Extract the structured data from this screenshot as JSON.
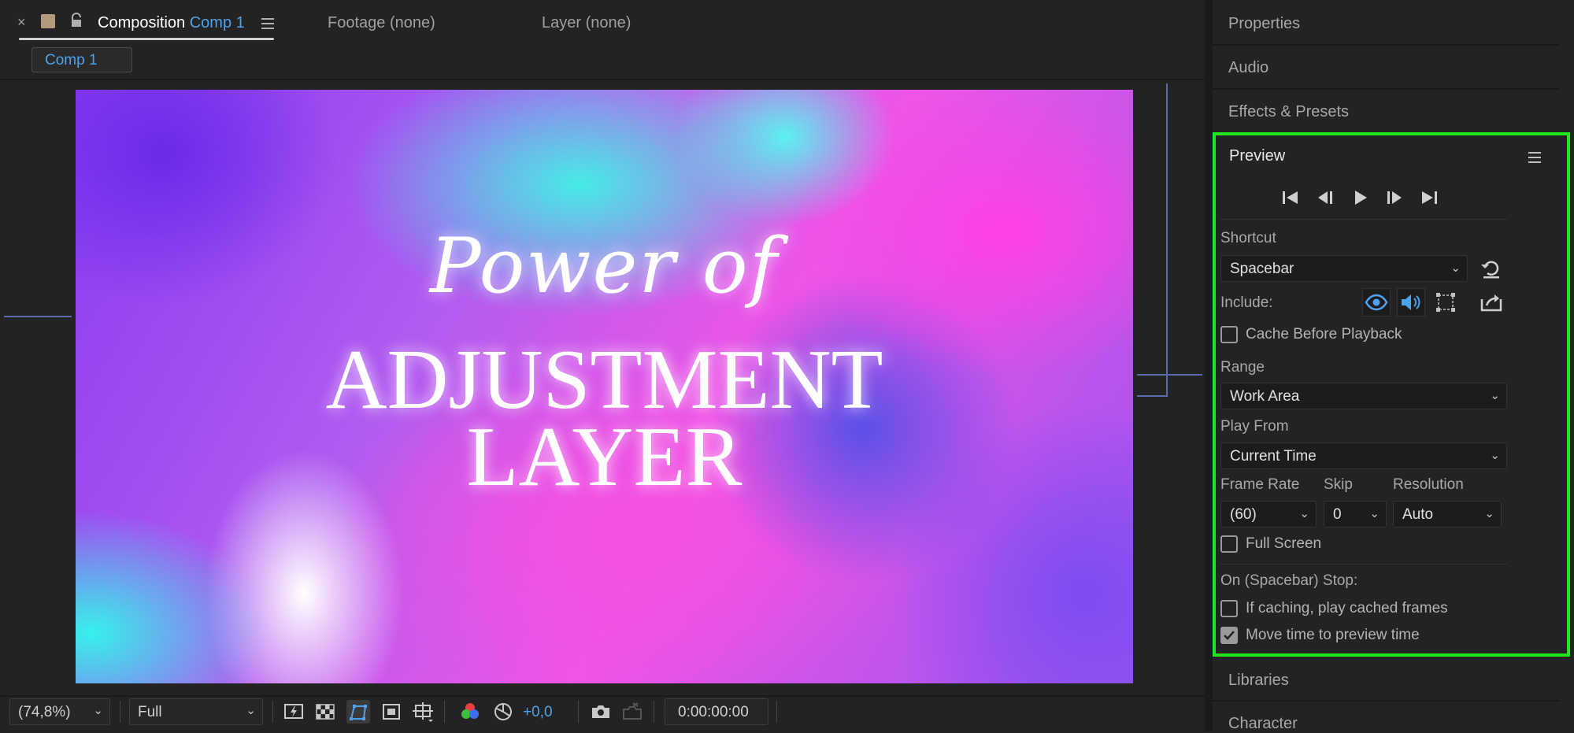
{
  "tabs": {
    "close_glyph": "×",
    "composition_label": "Composition",
    "composition_name": "Comp 1",
    "footage_label": "Footage (none)",
    "layer_label": "Layer (none)",
    "subtab_label": "Comp 1"
  },
  "canvas": {
    "script_title": "Power of",
    "main_title_line1": "ADJUSTMENT",
    "main_title_line2": "LAYER"
  },
  "bottom_toolbar": {
    "zoom_value": "(74,8%)",
    "resolution_value": "Full",
    "exposure_value": "+0,0",
    "timecode": "0:00:00:00"
  },
  "right_panel": {
    "properties": "Properties",
    "audio": "Audio",
    "effects_presets": "Effects & Presets",
    "libraries": "Libraries",
    "character": "Character"
  },
  "preview": {
    "title": "Preview",
    "shortcut_label": "Shortcut",
    "shortcut_value": "Spacebar",
    "include_label": "Include:",
    "cache_before_playback": "Cache Before Playback",
    "range_label": "Range",
    "range_value": "Work Area",
    "play_from_label": "Play From",
    "play_from_value": "Current Time",
    "frame_rate_label": "Frame Rate",
    "frame_rate_value": "(60)",
    "skip_label": "Skip",
    "skip_value": "0",
    "resolution_label": "Resolution",
    "resolution_value": "Auto",
    "full_screen": "Full Screen",
    "stop_label": "On (Spacebar) Stop:",
    "if_caching": "If caching, play cached frames",
    "move_time": "Move time to preview time",
    "cache_before_playback_checked": false,
    "full_screen_checked": false,
    "if_caching_checked": false,
    "move_time_checked": true
  },
  "colors": {
    "accent_blue": "#4ea1ea",
    "highlight_green": "#1ee81e",
    "panel_bg": "#232323"
  }
}
